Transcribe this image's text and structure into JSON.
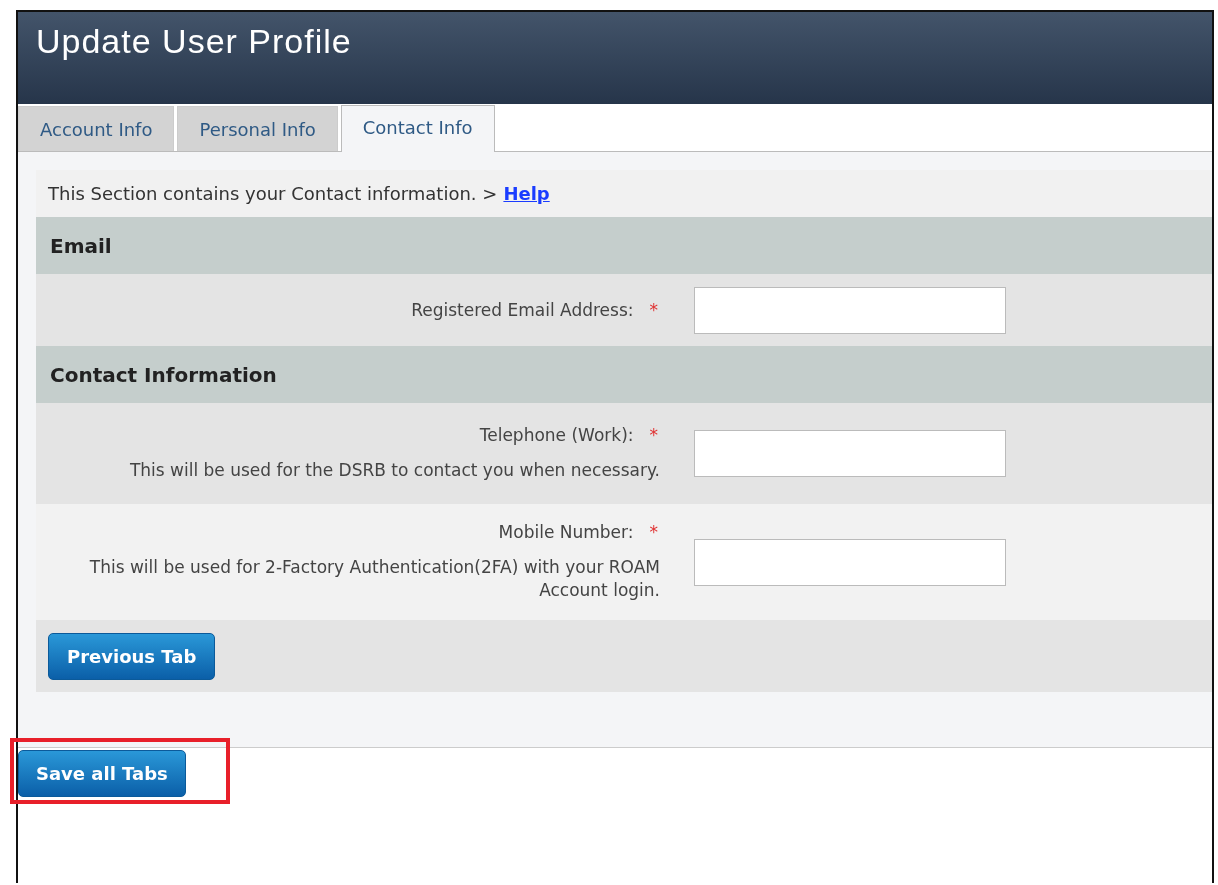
{
  "window": {
    "title": "Update User Profile"
  },
  "tabs": [
    {
      "label": "Account Info",
      "selected": false
    },
    {
      "label": "Personal Info",
      "selected": false
    },
    {
      "label": "Contact Info",
      "selected": true
    }
  ],
  "intro": {
    "text": "This Section contains your Contact information. >",
    "link": "Help"
  },
  "sections": [
    {
      "title": "Email",
      "fields": [
        {
          "label": "Registered Email Address:",
          "required": true,
          "required_mark": "*"
        }
      ]
    },
    {
      "title": "Contact Information",
      "fields": [
        {
          "label": "Telephone (Work):",
          "required": true,
          "required_mark": "*",
          "help": "This will be used for the DSRB to contact you when necessary."
        },
        {
          "label": "Mobile Number:",
          "required": true,
          "required_mark": "*",
          "help": "This will be used for 2-Factory Authentication(2FA) with your ROAM Account login."
        }
      ]
    }
  ],
  "previous_button": "Previous Tab",
  "save_button": {
    "label": "Save all Tabs",
    "highlighted": true
  }
}
